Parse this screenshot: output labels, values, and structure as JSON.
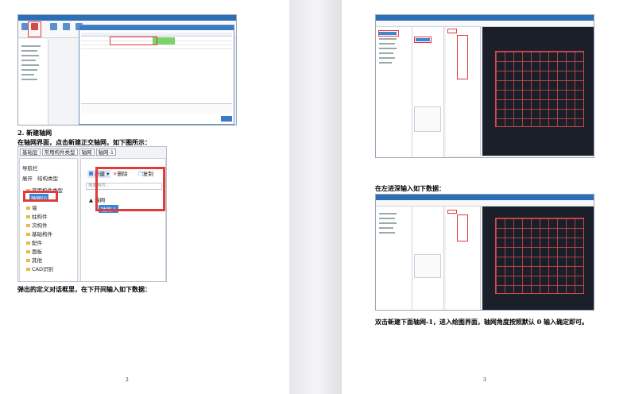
{
  "left_page": {
    "heading": "2. 新建轴网",
    "instruction": "在轴网界面，点击新建正交轴网，如下图所示：",
    "after_text": "弹出的定义对话框里，在下开间输入如下数据：",
    "page_number": "2",
    "zoom_panel": {
      "selects": [
        "基础层",
        "常用构件类型",
        "轴网",
        "轴网-1"
      ],
      "nav_title": "导航栏",
      "nav_buttons": [
        "展开",
        "结构类型"
      ],
      "nav_items": [
        "常用构件类型",
        "轴网(J)",
        "墙",
        "柱构件",
        "次构件",
        "基础构件",
        "配件",
        "面板",
        "其他",
        "CAD识别"
      ],
      "toolbar": [
        "新建",
        "删除",
        "复制"
      ],
      "search_placeholder": "搜索构件...",
      "tree_root": "轴网",
      "tree_child": "轴网-1"
    }
  },
  "right_page": {
    "caption_mid": "在左进深输入如下数据：",
    "caption_bottom": "双击新建下面轴网-1，进入绘图界面，轴网角度按照默认 0 输入确定即可。",
    "page_number": "3"
  },
  "colors": {
    "accent_red": "#e23b3b",
    "title_blue": "#2a6fb8",
    "cad_bg": "#1a1f2a"
  }
}
